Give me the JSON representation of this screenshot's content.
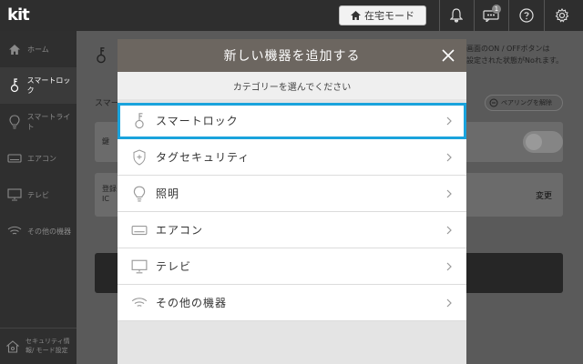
{
  "topbar": {
    "logo": "kit",
    "home_mode_label": "在宅モード",
    "message_badge": "1"
  },
  "sidebar": {
    "items": [
      {
        "label": "ホーム",
        "icon": "home-icon"
      },
      {
        "label": "スマートロック",
        "icon": "key-icon"
      },
      {
        "label": "スマートライト",
        "icon": "bulb-icon"
      },
      {
        "label": "エアコン",
        "icon": "aircon-icon"
      },
      {
        "label": "テレビ",
        "icon": "tv-icon"
      },
      {
        "label": "その他の機器",
        "icon": "wifi-icon"
      }
    ],
    "footer": "セキュリティ情報/ モード設定"
  },
  "main": {
    "note_line1": "画面のON / OFFボタンは",
    "note_line2": "設定された状態がNoれます。",
    "section_label": "スマー",
    "pairing_label": "ペアリングを解除",
    "card1_label": "鍵",
    "card2_label_line1": "登録",
    "card2_label_line2": "IC",
    "change_label": "変更"
  },
  "modal": {
    "title": "新しい機器を追加する",
    "subtitle": "カテゴリーを選んでください",
    "categories": [
      {
        "label": "スマートロック",
        "icon": "key-icon",
        "selected": true
      },
      {
        "label": "タグセキュリティ",
        "icon": "shield-icon",
        "selected": false
      },
      {
        "label": "照明",
        "icon": "bulb-icon",
        "selected": false
      },
      {
        "label": "エアコン",
        "icon": "aircon-icon",
        "selected": false
      },
      {
        "label": "テレビ",
        "icon": "tv-icon",
        "selected": false
      },
      {
        "label": "その他の機器",
        "icon": "wifi-icon",
        "selected": false
      }
    ]
  },
  "colors": {
    "accent": "#1aa3dc",
    "modal_header": "#6c6660",
    "topbar": "#2e2e2e"
  }
}
